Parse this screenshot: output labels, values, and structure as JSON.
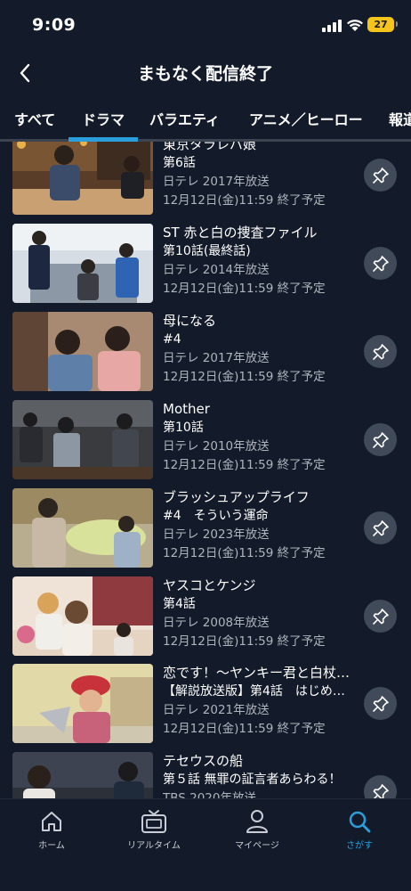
{
  "status_bar": {
    "time": "9:09",
    "battery": "27"
  },
  "header": {
    "title": "まもなく配信終了"
  },
  "tabs": [
    {
      "label": "すべて"
    },
    {
      "label": "ドラマ"
    },
    {
      "label": "バラエティ"
    },
    {
      "label": "アニメ／ヒーロー"
    },
    {
      "label": "報道"
    }
  ],
  "selected_tab": "ドラマ",
  "items": [
    {
      "title": "東京タラレバ娘",
      "episode": "第6話",
      "broadcast": "日テレ 2017年放送",
      "end": "12月12日(金)11:59 終了予定"
    },
    {
      "title": "ST 赤と白の捜査ファイル",
      "episode": "第10話(最終話)",
      "broadcast": "日テレ 2014年放送",
      "end": "12月12日(金)11:59 終了予定"
    },
    {
      "title": "母になる",
      "episode": "#4",
      "broadcast": "日テレ 2017年放送",
      "end": "12月12日(金)11:59 終了予定"
    },
    {
      "title": "Mother",
      "episode": "第10話",
      "broadcast": "日テレ 2010年放送",
      "end": "12月12日(金)11:59 終了予定"
    },
    {
      "title": "ブラッシュアップライフ",
      "episode": "#4　そういう運命",
      "broadcast": "日テレ 2023年放送",
      "end": "12月12日(金)11:59 終了予定"
    },
    {
      "title": "ヤスコとケンジ",
      "episode": "第4話",
      "broadcast": "日テレ 2008年放送",
      "end": "12月12日(金)11:59 終了予定"
    },
    {
      "title": "恋です！〜ヤンキー君と白杖…",
      "episode": "【解説放送版】第4話　はじめ…",
      "broadcast": "日テレ 2021年放送",
      "end": "12月12日(金)11:59 終了予定"
    },
    {
      "title": "テセウスの船",
      "episode": "第５話 無罪の証言者あらわる！",
      "broadcast": "TBS 2020年放送",
      "end": ""
    }
  ],
  "bottom_nav": [
    {
      "label": "ホーム",
      "icon": "home-icon"
    },
    {
      "label": "リアルタイム",
      "icon": "tv-icon"
    },
    {
      "label": "マイページ",
      "icon": "person-icon"
    },
    {
      "label": "さがす",
      "icon": "search-icon"
    }
  ],
  "colors": {
    "accent": "#2a9fdc",
    "background": "#131b2a",
    "pin_button": "#414a59"
  }
}
